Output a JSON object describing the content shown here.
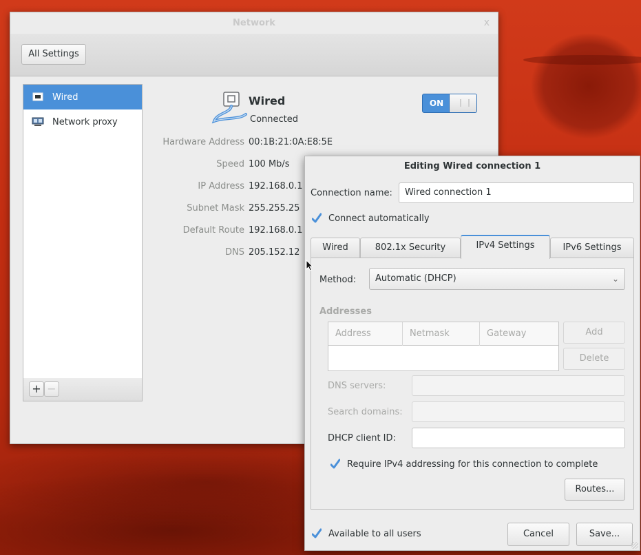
{
  "network_window": {
    "title": "Network",
    "close_glyph": "x",
    "all_settings_label": "All Settings",
    "sidebar": {
      "items": [
        {
          "label": "Wired",
          "icon": "wired-network-icon",
          "selected": true
        },
        {
          "label": "Network proxy",
          "icon": "network-proxy-icon",
          "selected": false
        }
      ],
      "add_label": "+",
      "remove_label": "−"
    },
    "device": {
      "icon": "wired-cable-icon",
      "title": "Wired",
      "status": "Connected",
      "switch_label": "ON",
      "switch_on": true
    },
    "details": [
      {
        "label": "Hardware Address",
        "value": "00:1B:21:0A:E8:5E"
      },
      {
        "label": "Speed",
        "value": "100 Mb/s"
      },
      {
        "label": "IP Address",
        "value": "192.168.0.1"
      },
      {
        "label": "Subnet Mask",
        "value": "255.255.25"
      },
      {
        "label": "Default Route",
        "value": "192.168.0.1"
      },
      {
        "label": "DNS",
        "value": "205.152.12"
      }
    ]
  },
  "edit_dialog": {
    "title": "Editing Wired connection 1",
    "connection_name_label": "Connection name:",
    "connection_name_value": "Wired connection 1",
    "connect_automatically_label": "Connect automatically",
    "connect_automatically_checked": true,
    "tabs": [
      {
        "label": "Wired",
        "active": false
      },
      {
        "label": "802.1x Security",
        "active": false
      },
      {
        "label": "IPv4 Settings",
        "active": true
      },
      {
        "label": "IPv6 Settings",
        "active": false
      }
    ],
    "ipv4": {
      "method_label": "Method:",
      "method_value": "Automatic (DHCP)",
      "addresses_heading": "Addresses",
      "address_columns": [
        "Address",
        "Netmask",
        "Gateway"
      ],
      "add_label": "Add",
      "delete_label": "Delete",
      "dns_servers_label": "DNS servers:",
      "search_domains_label": "Search domains:",
      "dhcp_client_id_label": "DHCP client ID:",
      "require_ipv4_label": "Require IPv4 addressing for this connection to complete",
      "require_ipv4_checked": true,
      "routes_label": "Routes..."
    },
    "available_all_users_label": "Available to all users",
    "available_all_users_checked": true,
    "cancel_label": "Cancel",
    "save_label": "Save..."
  },
  "colors": {
    "accent": "#4a90d9",
    "desktop_red": "#c32e12"
  }
}
